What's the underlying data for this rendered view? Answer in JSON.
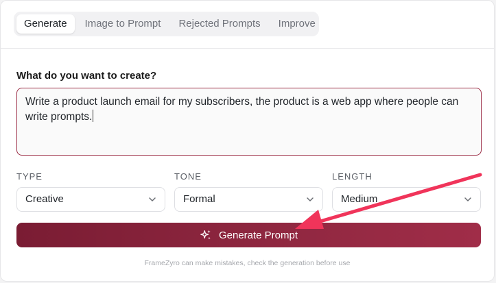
{
  "tabs": [
    {
      "label": "Generate",
      "active": true
    },
    {
      "label": "Image to Prompt",
      "active": false
    },
    {
      "label": "Rejected Prompts",
      "active": false
    },
    {
      "label": "Improve",
      "active": false
    }
  ],
  "form": {
    "question": "What do you want to create?",
    "prompt_value": "Write a product launch email for my subscribers, the product is a web app where people can write prompts."
  },
  "options": {
    "type": {
      "label": "TYPE",
      "value": "Creative"
    },
    "tone": {
      "label": "TONE",
      "value": "Formal"
    },
    "length": {
      "label": "LENGTH",
      "value": "Medium"
    }
  },
  "actions": {
    "generate_label": "Generate Prompt",
    "icon": "sparkles-icon"
  },
  "footer": {
    "disclaimer": "FrameZyro can make mistakes, check the generation before use"
  },
  "colors": {
    "accent": "#8f2740",
    "annotation_arrow": "#f0345a"
  }
}
